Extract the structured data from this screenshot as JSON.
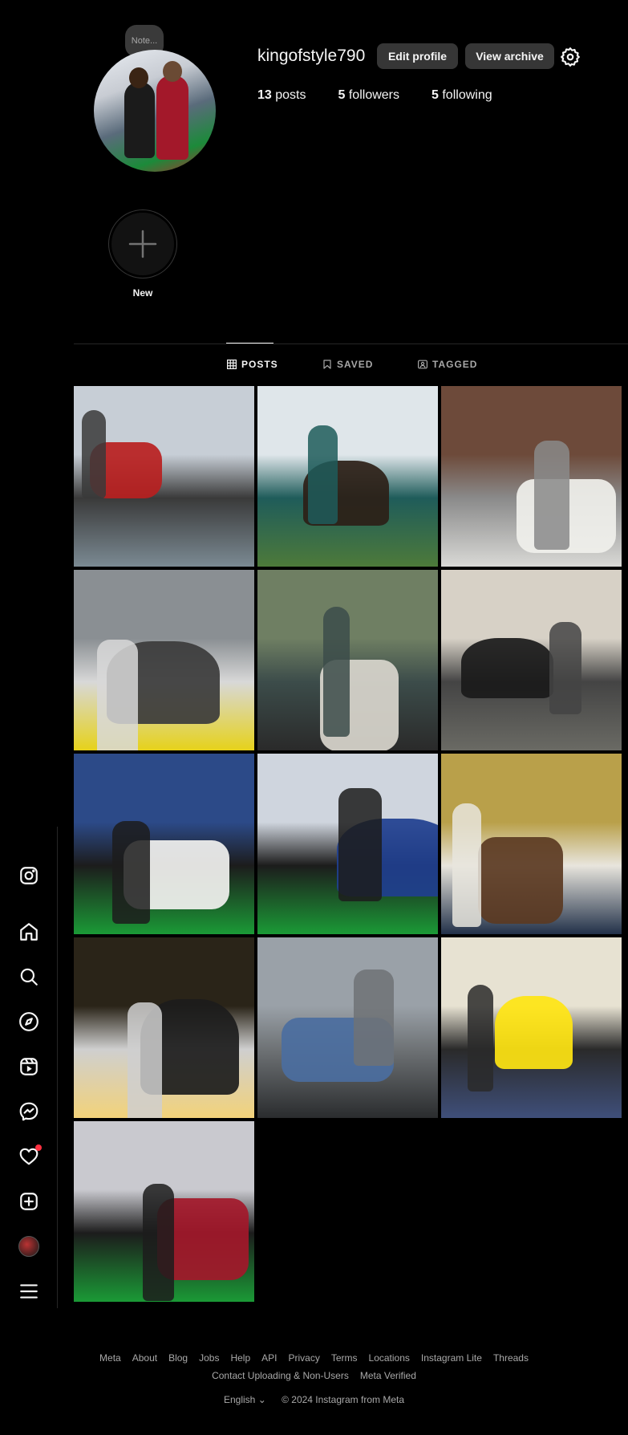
{
  "profile": {
    "note_text": "Note...",
    "username": "kingofstyle790",
    "edit_label": "Edit profile",
    "archive_label": "View archive",
    "posts_count": "13",
    "posts_label": "posts",
    "followers_count": "5",
    "followers_label": "followers",
    "following_count": "5",
    "following_label": "following"
  },
  "highlights": {
    "new_label": "New"
  },
  "tabs": [
    {
      "label": "POSTS",
      "icon": "grid-icon",
      "active": true
    },
    {
      "label": "SAVED",
      "icon": "bookmark-icon",
      "active": false
    },
    {
      "label": "TAGGED",
      "icon": "tag-person-icon",
      "active": false
    }
  ],
  "sidebar": {
    "items": [
      {
        "name": "instagram-logo-icon"
      },
      {
        "name": "home-icon"
      },
      {
        "name": "search-icon"
      },
      {
        "name": "explore-icon"
      },
      {
        "name": "reels-icon"
      },
      {
        "name": "messenger-icon"
      },
      {
        "name": "notifications-heart-icon"
      },
      {
        "name": "create-icon"
      },
      {
        "name": "profile-avatar"
      },
      {
        "name": "menu-icon"
      }
    ]
  },
  "posts": [
    {
      "desc": "red sports car",
      "colors": [
        "#c7ced6",
        "#7b8a93",
        "#b81f1f",
        "#3a3a3a"
      ]
    },
    {
      "desc": "selfie in garden dome",
      "colors": [
        "#dfe6ea",
        "#4d7a3a",
        "#2c1f17",
        "#1f5c5a"
      ]
    },
    {
      "desc": "white porsche",
      "colors": [
        "#6d4a3a",
        "#d9d9d6",
        "#f0f0ec",
        "#8a8a8a"
      ]
    },
    {
      "desc": "yellow car front",
      "colors": [
        "#8a8f93",
        "#e6d21a",
        "#3b3b3b",
        "#d8d8d8"
      ]
    },
    {
      "desc": "man with classic car",
      "colors": [
        "#6f7f63",
        "#2a2a2a",
        "#d9d6cd",
        "#3c4c4a"
      ]
    },
    {
      "desc": "black porsche cobblestone",
      "colors": [
        "#d7d1c6",
        "#6a6a64",
        "#1a1a1a",
        "#444"
      ]
    },
    {
      "desc": "cricket wax figure",
      "colors": [
        "#2c4a88",
        "#1b9a36",
        "#f2f2f0",
        "#1c1c1c"
      ]
    },
    {
      "desc": "locker room figure",
      "colors": [
        "#cfd5de",
        "#1b9a36",
        "#1f3f8f",
        "#1c1c1c"
      ]
    },
    {
      "desc": "group selfie",
      "colors": [
        "#b9a04a",
        "#223149",
        "#5b3a22",
        "#e8e5dd"
      ]
    },
    {
      "desc": "lights wax figure",
      "colors": [
        "#2a2418",
        "#f2d27a",
        "#1c1c1c",
        "#cfcfcf"
      ]
    },
    {
      "desc": "rolls royce street",
      "colors": [
        "#9aa1a8",
        "#2a2c2e",
        "#4b6ea0",
        "#6e7275"
      ]
    },
    {
      "desc": "man with yellow car",
      "colors": [
        "#e7e2d2",
        "#3f4f7a",
        "#ffe512",
        "#2a2a2a"
      ]
    },
    {
      "desc": "football wax figure",
      "colors": [
        "#c9c9cf",
        "#1b9a36",
        "#a3182a",
        "#1c1c1c"
      ]
    }
  ],
  "footer": {
    "links": [
      "Meta",
      "About",
      "Blog",
      "Jobs",
      "Help",
      "API",
      "Privacy",
      "Terms",
      "Locations",
      "Instagram Lite",
      "Threads",
      "Contact Uploading & Non-Users",
      "Meta Verified"
    ],
    "language": "English",
    "copyright": "© 2024 Instagram from Meta"
  }
}
